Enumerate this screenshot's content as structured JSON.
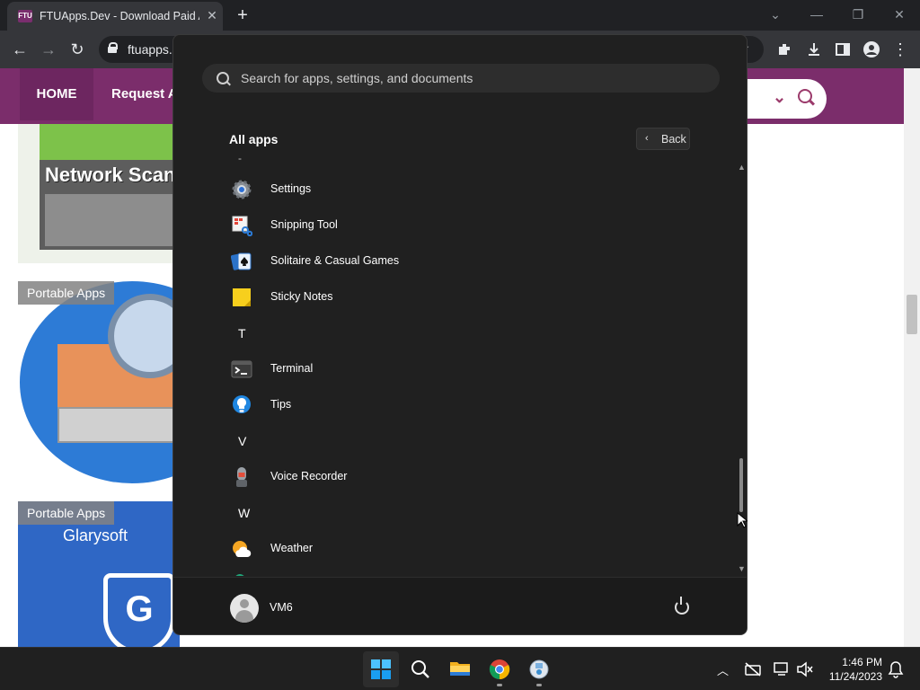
{
  "browser": {
    "tab_title": "FTUApps.Dev - Download Paid Ap",
    "tab_favicon_text": "FTU",
    "new_tab_label": "+",
    "url": "ftuapps.",
    "window_controls": [
      "chevron-down-icon",
      "minimize-icon",
      "restore-icon",
      "close-icon"
    ]
  },
  "website": {
    "nav_items": [
      "HOME",
      "Request A"
    ],
    "brand_color": "#7b2d6b",
    "cards": [
      {
        "image_text": "Network Scan"
      },
      {
        "badge": "Portable Apps"
      },
      {
        "badge": "Portable Apps",
        "image_text": "Glarysoft",
        "shield_letter": "G"
      }
    ]
  },
  "start_menu": {
    "search_placeholder": "Search for apps, settings, and documents",
    "all_apps_label": "All apps",
    "back_label": "Back",
    "partial_top_letter": "-",
    "items": [
      {
        "type": "app",
        "label": "Settings",
        "icon": "settings-icon"
      },
      {
        "type": "app",
        "label": "Snipping Tool",
        "icon": "snipping-tool-icon"
      },
      {
        "type": "app",
        "label": "Solitaire & Casual Games",
        "icon": "solitaire-icon"
      },
      {
        "type": "app",
        "label": "Sticky Notes",
        "icon": "sticky-notes-icon"
      },
      {
        "type": "letter",
        "label": "T"
      },
      {
        "type": "app",
        "label": "Terminal",
        "icon": "terminal-icon"
      },
      {
        "type": "app",
        "label": "Tips",
        "icon": "tips-icon"
      },
      {
        "type": "letter",
        "label": "V"
      },
      {
        "type": "app",
        "label": "Voice Recorder",
        "icon": "voice-recorder-icon"
      },
      {
        "type": "letter",
        "label": "W"
      },
      {
        "type": "app",
        "label": "Weather",
        "icon": "weather-icon"
      }
    ],
    "user_name": "VM6"
  },
  "taskbar": {
    "apps": [
      "start-icon",
      "search-icon",
      "file-explorer-icon",
      "chrome-icon",
      "recorder-icon"
    ],
    "time": "1:46 PM",
    "date": "11/24/2023"
  },
  "colors": {
    "start_bg": "#202020",
    "accent": "#60cdff"
  }
}
